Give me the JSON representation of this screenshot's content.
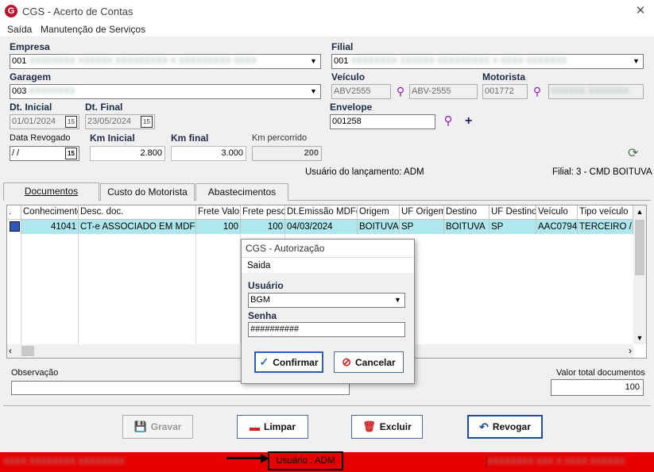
{
  "window": {
    "title": "CGS - Acerto de Contas",
    "app_icon_letter": "G"
  },
  "menu": [
    "Saída",
    "Manutenção de Serviços"
  ],
  "form": {
    "empresa": {
      "label": "Empresa",
      "value": "001"
    },
    "filial": {
      "label": "Filial",
      "value": "001"
    },
    "garagem": {
      "label": "Garagem",
      "value": "003"
    },
    "veiculo": {
      "label": "Veículo",
      "code": "ABV2555",
      "plate": "ABV-2555"
    },
    "motorista": {
      "label": "Motorista",
      "code": "001772"
    },
    "dt_inicial": {
      "label": "Dt. Inicial",
      "value": "01/01/2024"
    },
    "dt_final": {
      "label": "Dt. Final",
      "value": "23/05/2024"
    },
    "envelope": {
      "label": "Envelope",
      "value": "001258"
    },
    "data_revogado": {
      "label": "Data Revogado",
      "value": " / /"
    },
    "km_inicial": {
      "label": "Km Inicial",
      "value": "2.800"
    },
    "km_final": {
      "label": "Km final",
      "value": "3.000"
    },
    "km_percorrido": {
      "label": "Km percorrido",
      "value": "200"
    },
    "usuario_lancamento": "Usuário do lançamento: ADM",
    "filial_info": "Filial: 3 - CMD BOITUVA",
    "calendar_icon_text": "15"
  },
  "tabs": [
    "Documentos",
    "Custo do Motorista",
    "Abastecimentos"
  ],
  "grid": {
    "columns": [
      ".",
      "Conhecimento",
      "Desc. doc.",
      "Frete Valor",
      "Frete peso",
      "Dt.Emissão MDFe",
      "Origem",
      "UF Origem",
      "Destino",
      "UF Destino",
      "Veículo",
      "Tipo veículo"
    ],
    "rows": [
      [
        "",
        "41041",
        "CT-e ASSOCIADO EM MDF-e",
        "100",
        "100",
        "04/03/2024",
        "BOITUVA",
        "SP",
        "BOITUVA",
        "SP",
        "AAC0794",
        "TERCEIRO / A"
      ]
    ]
  },
  "observacao_label": "Observação",
  "valor_total": {
    "label": "Valor total documentos",
    "value": "100"
  },
  "buttons": {
    "gravar": "Gravar",
    "limpar": "Limpar",
    "excluir": "Excluir",
    "revogar": "Revogar"
  },
  "statusbar": {
    "usuario": "Usuário : ADM",
    "accent": "#e60000"
  },
  "dialog": {
    "title": "CGS - Autorização",
    "menu": "Saida",
    "usuario_label": "Usuário",
    "usuario_value": "BGM",
    "senha_label": "Senha",
    "senha_value": "##########",
    "confirmar": "Confirmar",
    "cancelar": "Cancelar"
  }
}
